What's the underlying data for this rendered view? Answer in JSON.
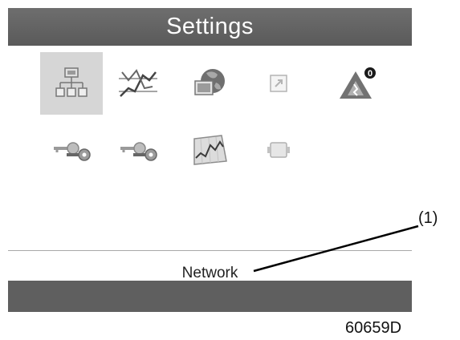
{
  "header": {
    "title": "Settings"
  },
  "icons": [
    {
      "name": "network-icon",
      "selected": true
    },
    {
      "name": "regulation-icon",
      "selected": false
    },
    {
      "name": "globe-icon",
      "selected": false
    },
    {
      "name": "export-icon",
      "selected": false
    },
    {
      "name": "service-alert-icon",
      "selected": false,
      "badge": "0"
    },
    {
      "name": "access-key-icon",
      "selected": false
    },
    {
      "name": "access-key-icon",
      "selected": false
    },
    {
      "name": "trend-chart-icon",
      "selected": false
    },
    {
      "name": "device-icon",
      "selected": false
    }
  ],
  "status": {
    "selected_label": "Network"
  },
  "callout": {
    "label": "(1)"
  },
  "figure": {
    "code": "60659D"
  }
}
